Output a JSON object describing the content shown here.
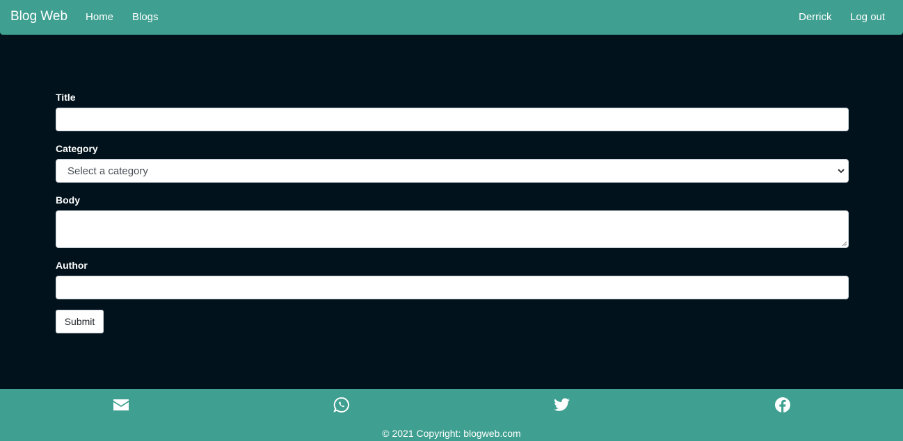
{
  "navbar": {
    "brand": "Blog Web",
    "links": [
      {
        "label": "Home"
      },
      {
        "label": "Blogs"
      }
    ],
    "user": "Derrick",
    "logout": "Log out"
  },
  "form": {
    "title_label": "Title",
    "title_value": "",
    "category_label": "Category",
    "category_selected": "Select a category",
    "body_label": "Body",
    "body_value": "",
    "author_label": "Author",
    "author_value": "",
    "submit_label": "Submit"
  },
  "footer": {
    "icons": [
      "envelope-icon",
      "whatsapp-icon",
      "twitter-icon",
      "facebook-icon"
    ],
    "copyright": "© 2021 Copyright: blogweb.com"
  },
  "colors": {
    "accent": "#3f9f90",
    "background": "#01121c",
    "text": "#ffffff"
  }
}
